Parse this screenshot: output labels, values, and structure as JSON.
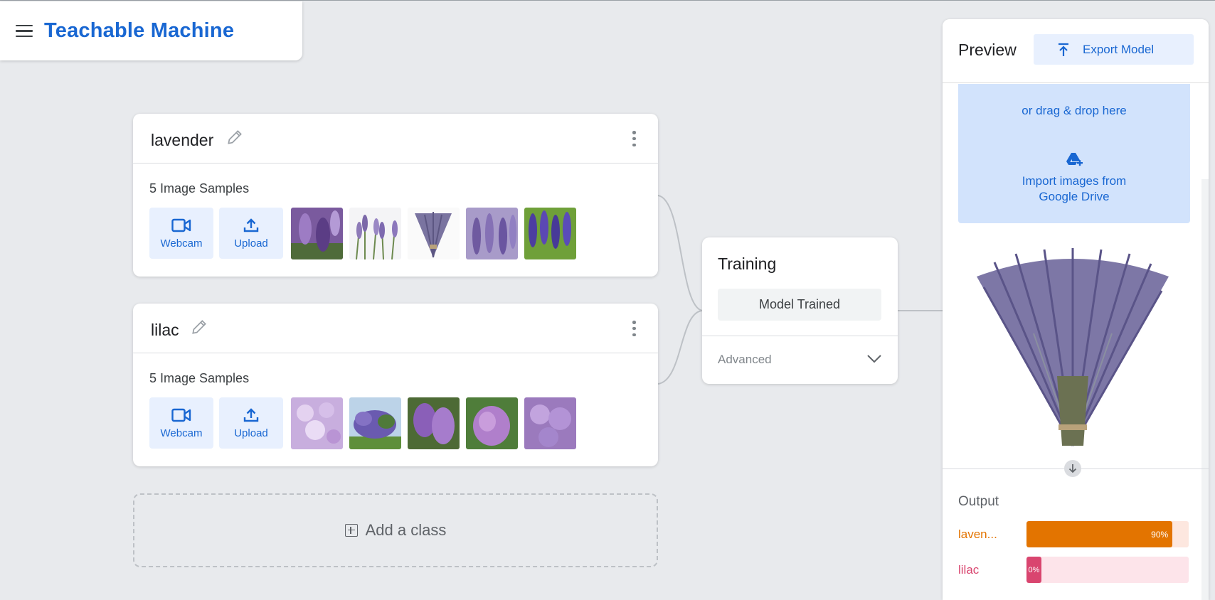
{
  "app": {
    "title": "Teachable Machine"
  },
  "classes": [
    {
      "name": "lavender",
      "samples_label": "5 Image Samples",
      "webcam_label": "Webcam",
      "upload_label": "Upload"
    },
    {
      "name": "lilac",
      "samples_label": "5 Image Samples",
      "webcam_label": "Webcam",
      "upload_label": "Upload"
    }
  ],
  "add_class": {
    "label": "Add a class"
  },
  "training": {
    "title": "Training",
    "button_label": "Model Trained",
    "advanced_label": "Advanced"
  },
  "preview": {
    "title": "Preview",
    "export_label": "Export Model",
    "drop_text": "or drag & drop here",
    "drive_line1": "Import images from",
    "drive_line2": "Google Drive",
    "output_title": "Output",
    "outputs": [
      {
        "label": "laven...",
        "percent_text": "90%",
        "percent": 90,
        "color": "#e37400",
        "track_color": "#fde7df"
      },
      {
        "label": "lilac",
        "percent_text": "0%",
        "percent": 0,
        "color": "#d9456f",
        "track_color": "#fde4ea"
      }
    ]
  },
  "colors": {
    "accent": "#1967d2",
    "background": "#e8eaed"
  }
}
